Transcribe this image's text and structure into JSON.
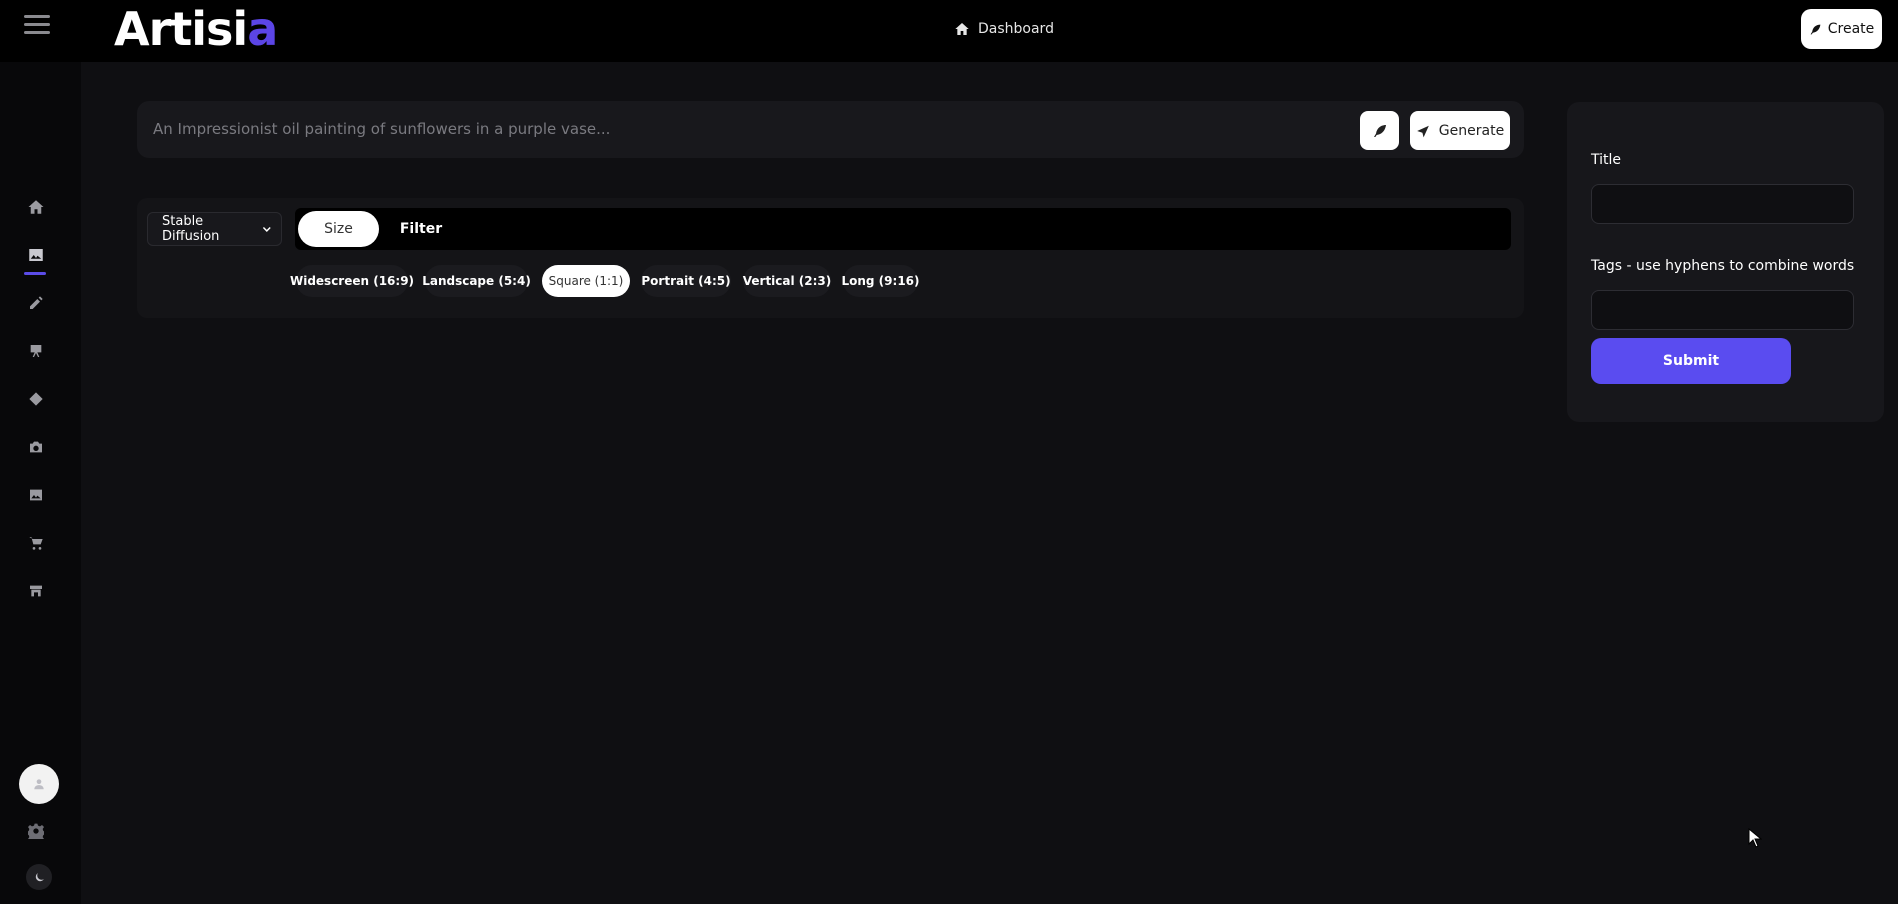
{
  "app": {
    "logo_text_main": "Artisi",
    "logo_text_accent": "a",
    "brand_color": "#5b4ce8"
  },
  "topbar": {
    "nav_center_label": "Dashboard",
    "create_label": "Create"
  },
  "sidebar": {
    "items": [
      {
        "icon": "home-icon"
      },
      {
        "icon": "image-icon",
        "active": true
      },
      {
        "icon": "pencil-icon"
      },
      {
        "icon": "easel-icon"
      },
      {
        "icon": "diamond-icon"
      },
      {
        "icon": "camera-icon"
      },
      {
        "icon": "gallery-icon"
      },
      {
        "icon": "cart-icon"
      },
      {
        "icon": "store-icon"
      }
    ],
    "bottom": [
      "avatar",
      "gear-icon",
      "moon-icon"
    ]
  },
  "prompt": {
    "placeholder": "An Impressionist oil painting of sunflowers in a purple vase...",
    "value": "",
    "generate_label": "Generate"
  },
  "options": {
    "model_selected": "Stable Diffusion",
    "tabs": [
      {
        "label": "Size",
        "active": true
      },
      {
        "label": "Filter",
        "active": false
      }
    ],
    "sizes": [
      {
        "label": "Widescreen (16:9)",
        "active": false
      },
      {
        "label": "Landscape (5:4)",
        "active": false
      },
      {
        "label": "Square (1:1)",
        "active": true
      },
      {
        "label": "Portrait (4:5)",
        "active": false
      },
      {
        "label": "Vertical (2:3)",
        "active": false
      },
      {
        "label": "Long (9:16)",
        "active": false
      }
    ]
  },
  "form": {
    "title_label": "Title",
    "title_value": "",
    "tags_label": "Tags - use hyphens to combine words",
    "tags_value": "",
    "submit_label": "Submit"
  }
}
